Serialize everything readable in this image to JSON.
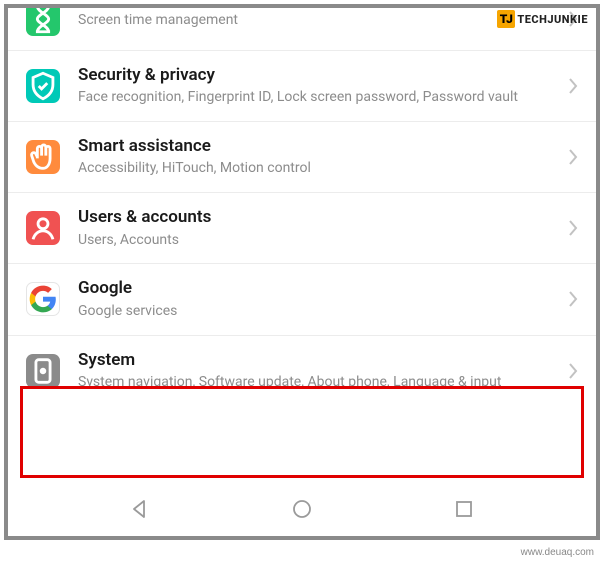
{
  "brand": {
    "logo_letter": "TJ",
    "name": "TECHJUNKIE"
  },
  "watermark": "www.deuaq.com",
  "rows": [
    {
      "title": "",
      "subtitle": "Screen time management"
    },
    {
      "title": "Security & privacy",
      "subtitle": "Face recognition, Fingerprint ID, Lock screen password, Password vault"
    },
    {
      "title": "Smart assistance",
      "subtitle": "Accessibility, HiTouch, Motion control"
    },
    {
      "title": "Users & accounts",
      "subtitle": "Users, Accounts"
    },
    {
      "title": "Google",
      "subtitle": "Google services"
    },
    {
      "title": "System",
      "subtitle": "System navigation, Software update, About phone, Language & input"
    }
  ]
}
